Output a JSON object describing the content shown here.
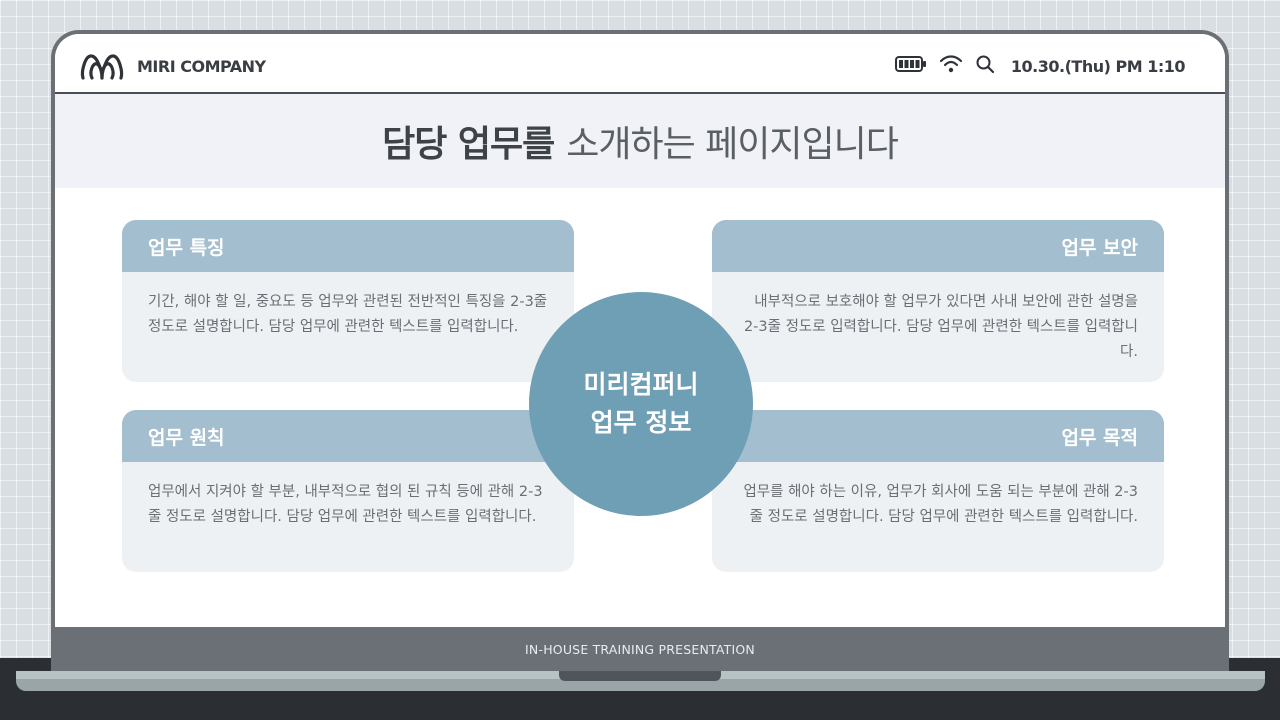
{
  "header": {
    "company": "MIRI COMPANY",
    "datetime": "10.30.(Thu) PM 1:10",
    "icons": [
      "logo-icon",
      "battery-icon",
      "wifi-icon",
      "search-icon"
    ]
  },
  "title": {
    "bold": "담당 업무를",
    "light": "소개하는 페이지입니다"
  },
  "center": {
    "line1": "미리컴퍼니",
    "line2": "업무 정보"
  },
  "cards": [
    {
      "title": "업무 특징",
      "body": "기간, 해야 할 일, 중요도 등 업무와 관련된 전반적인 특징을 2-3줄 정도로 설명합니다. 담당 업무에 관련한 텍스트를 입력합니다."
    },
    {
      "title": "업무 보안",
      "body": "내부적으로 보호해야 할 업무가 있다면 사내 보안에 관한 설명을 2-3줄 정도로 입력합니다. 담당 업무에 관련한 텍스트를 입력합니다."
    },
    {
      "title": "업무 원칙",
      "body": "업무에서 지켜야 할 부분, 내부적으로 협의 된 규칙 등에 관해 2-3줄 정도로 설명합니다. 담당 업무에 관련한 텍스트를 입력합니다."
    },
    {
      "title": "업무 목적",
      "body": "업무를 해야 하는 이유, 업무가 회사에 도움 되는 부분에 관해 2-3줄 정도로 설명합니다. 담당 업무에 관련한 텍스트를 입력합니다."
    }
  ],
  "footer": {
    "label": "IN-HOUSE TRAINING PRESENTATION"
  },
  "colors": {
    "accent": "#6f9fb5",
    "card_header": "#a3bfcf",
    "card_body": "#eef1f4",
    "title_band": "#f1f2f8",
    "frame": "#6b7076"
  }
}
